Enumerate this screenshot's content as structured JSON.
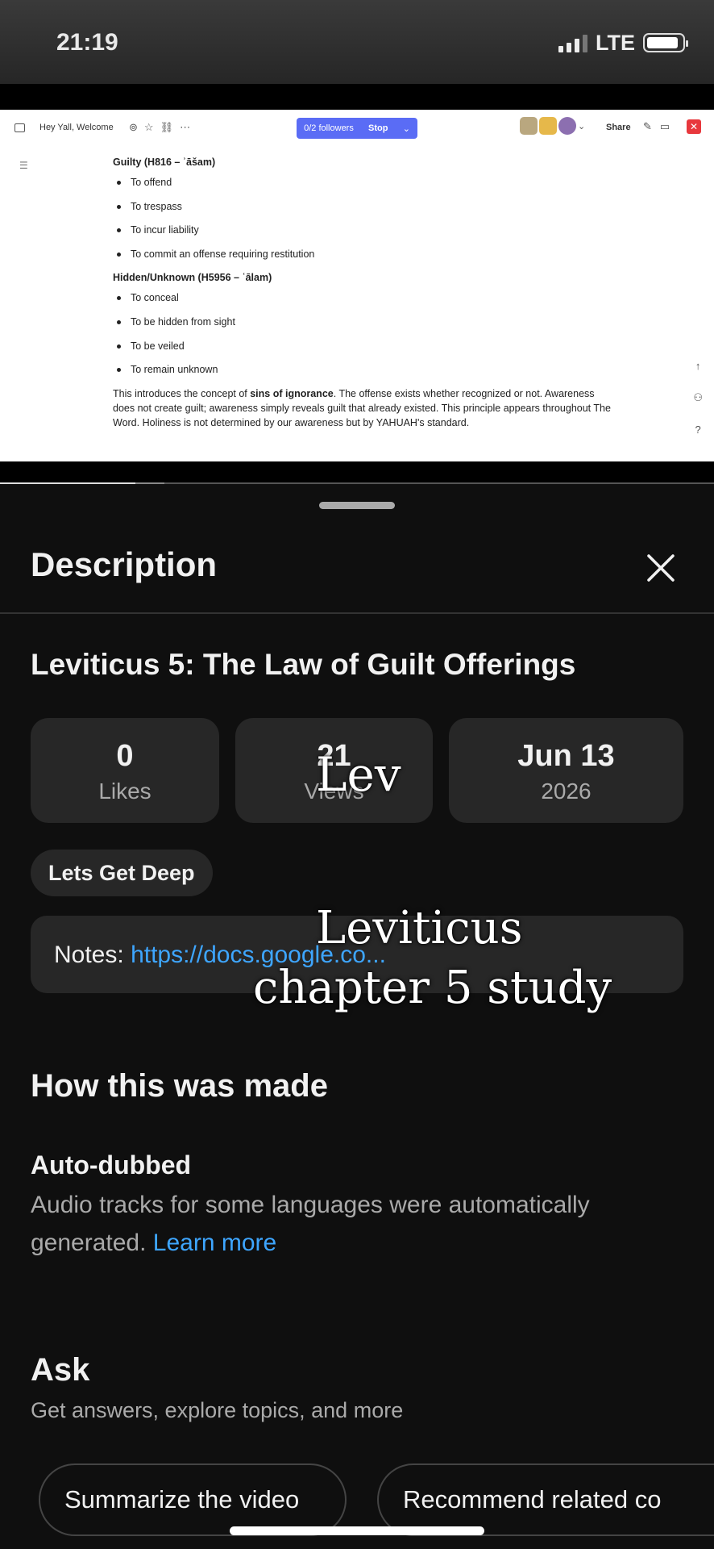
{
  "status_bar": {
    "time": "21:19",
    "network": "LTE",
    "battery_level": 0.9
  },
  "video": {
    "progress": 0.19,
    "buffered": 0.23,
    "doc": {
      "title": "Hey Yall, Welcome",
      "followers": "0/2 followers",
      "stop": "Stop",
      "share": "Share",
      "sections": [
        {
          "heading": "Guilty (H816 – ʾāšam)",
          "items": [
            "To offend",
            "To trespass",
            "To incur liability",
            "To commit an offense requiring restitution"
          ]
        },
        {
          "heading": "Hidden/Unknown (H5956 – ʿālam)",
          "items": [
            "To conceal",
            "To be hidden from sight",
            "To be veiled",
            "To remain unknown"
          ]
        }
      ],
      "paragraph_parts": [
        "This introduces the concept of ",
        "sins of ignorance",
        ". The offense exists whether recognized or not. Awareness does not create guilt; awareness simply reveals guilt that already existed. This principle appears throughout The Word. Holiness is not determined by our awareness but by YAHUAH's standard."
      ]
    }
  },
  "panel": {
    "title": "Description",
    "video_title": "Leviticus 5: The Law of Guilt Offerings",
    "stats": [
      {
        "value": "0",
        "label": "Likes"
      },
      {
        "value": "21",
        "label": "Views"
      },
      {
        "value": "Jun 13",
        "label": "2026"
      }
    ],
    "chip": "Lets Get Deep",
    "notes_label": "Notes:",
    "notes_link": "https://docs.google.co...",
    "how_made_title": "How this was made",
    "auto_dubbed_title": "Auto-dubbed",
    "auto_dubbed_text": "Audio tracks for some languages were automatically generated.",
    "learn_more": "Learn more",
    "ask_title": "Ask",
    "ask_subtitle": "Get answers, explore topics, and more",
    "prompts": [
      "Summarize the video",
      "Recommend related co"
    ]
  },
  "overlays": {
    "lev": "Lev",
    "line1": "Leviticus",
    "line2": "chapter 5 study"
  }
}
